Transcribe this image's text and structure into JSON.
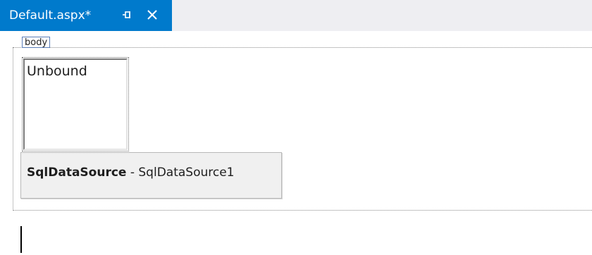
{
  "tab": {
    "title": "Default.aspx*",
    "pin_icon": "pin-icon",
    "close_icon": "close-icon"
  },
  "designer": {
    "body_tag": "body",
    "listbox_text": "Unbound",
    "sqldatasource": {
      "type": "SqlDataSource",
      "separator": " - ",
      "id": "SqlDataSource1"
    }
  },
  "colors": {
    "tab_active": "#007acc",
    "tabstrip_bg": "#eeeef2",
    "tag_border": "#5b7eb8",
    "control_bg": "#f0f0f0"
  }
}
